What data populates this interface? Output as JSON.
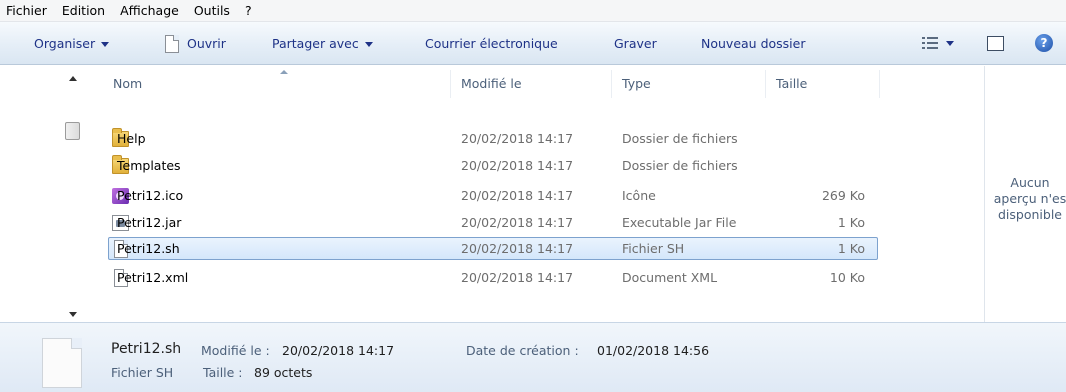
{
  "menu": [
    "Fichier",
    "Edition",
    "Affichage",
    "Outils",
    "?"
  ],
  "toolbar": {
    "organize": "Organiser",
    "open": "Ouvrir",
    "share": "Partager avec",
    "email": "Courrier électronique",
    "burn": "Graver",
    "new_folder": "Nouveau dossier",
    "icons": [
      "view-options-icon",
      "preview-pane-icon",
      "help-icon"
    ],
    "help_glyph": "?"
  },
  "columns": {
    "name": "Nom",
    "modified": "Modifié le",
    "type": "Type",
    "size": "Taille"
  },
  "files": [
    {
      "name": "Help",
      "modified": "20/02/2018 14:17",
      "type": "Dossier de fichiers",
      "size": "",
      "icon": "folder-icon"
    },
    {
      "name": "Templates",
      "modified": "20/02/2018 14:17",
      "type": "Dossier de fichiers",
      "size": "",
      "icon": "folder-icon"
    },
    {
      "name": "Petri12.ico",
      "modified": "20/02/2018 14:17",
      "type": "Icône",
      "size": "269 Ko",
      "icon": "ico-file-icon"
    },
    {
      "name": "Petri12.jar",
      "modified": "20/02/2018 14:17",
      "type": "Executable Jar File",
      "size": "1 Ko",
      "icon": "jar-file-icon"
    },
    {
      "name": "Petri12.sh",
      "modified": "20/02/2018 14:17",
      "type": "Fichier SH",
      "size": "1 Ko",
      "icon": "document-icon",
      "selected": true
    },
    {
      "name": "Petri12.xml",
      "modified": "20/02/2018 14:17",
      "type": "Document XML",
      "size": "10 Ko",
      "icon": "document-icon"
    }
  ],
  "preview": {
    "line1": "Aucun",
    "line2": "aperçu n'es",
    "line3": "disponible"
  },
  "details": {
    "name": "Petri12.sh",
    "modified_label": "Modifié le :",
    "modified_value": "20/02/2018 14:17",
    "created_label": "Date de création :",
    "created_value": "01/02/2018 14:56",
    "type": "Fichier SH",
    "size_label": "Taille :",
    "size_value": "89 octets"
  },
  "colors": {
    "toolbar_text": "#1e3287",
    "selection_border": "#7da2ce",
    "header_text": "#4c607a"
  }
}
